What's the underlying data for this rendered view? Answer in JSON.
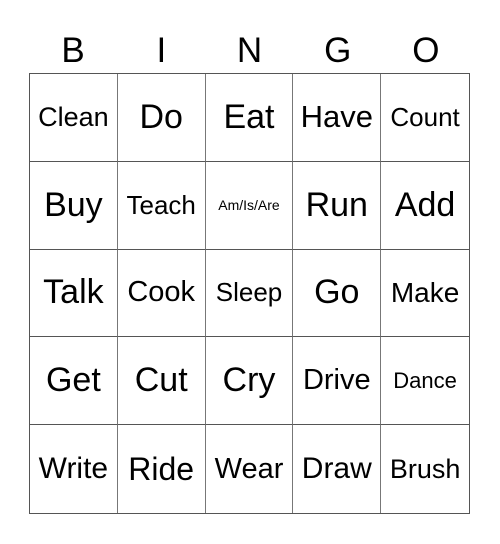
{
  "header": [
    "B",
    "I",
    "N",
    "G",
    "O"
  ],
  "cells": [
    [
      "Clean",
      "Do",
      "Eat",
      "Have",
      "Count"
    ],
    [
      "Buy",
      "Teach",
      "Am/Is/Are",
      "Run",
      "Add"
    ],
    [
      "Talk",
      "Cook",
      "Sleep",
      "Go",
      "Make"
    ],
    [
      "Get",
      "Cut",
      "Cry",
      "Drive",
      "Dance"
    ],
    [
      "Write",
      "Ride",
      "Wear",
      "Draw",
      "Brush"
    ]
  ]
}
